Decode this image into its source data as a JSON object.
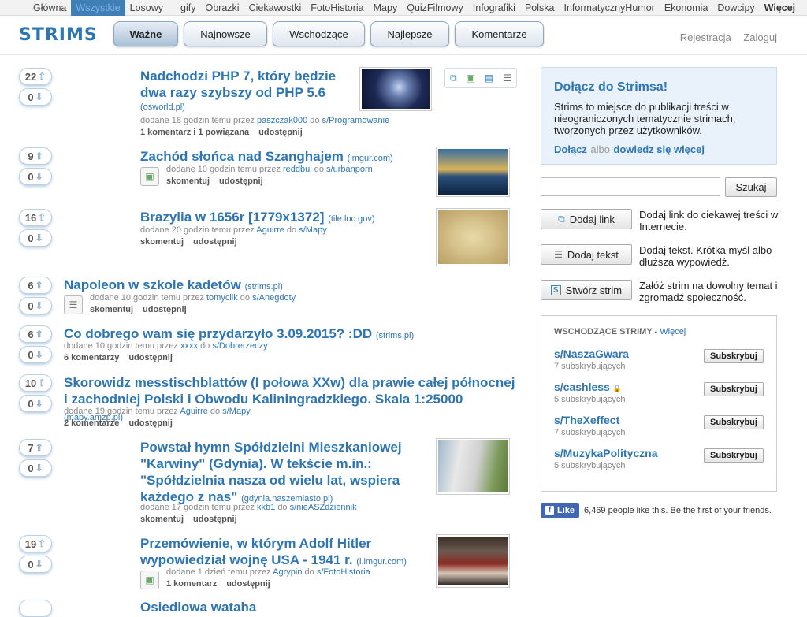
{
  "topnav": [
    {
      "label": "Główna"
    },
    {
      "label": "Wszystkie",
      "active": true
    },
    {
      "label": "Losowy"
    },
    {
      "label": "gify"
    },
    {
      "label": "Obrazki"
    },
    {
      "label": "Ciekawostki"
    },
    {
      "label": "FotoHistoria"
    },
    {
      "label": "Mapy"
    },
    {
      "label": "QuizFilmowy"
    },
    {
      "label": "Infografiki"
    },
    {
      "label": "Polska"
    },
    {
      "label": "InformatycznyHumor"
    },
    {
      "label": "Ekonomia"
    },
    {
      "label": "Dowcipy"
    },
    {
      "label": "Więcej",
      "bold": true
    }
  ],
  "logo": "STRIMS",
  "tabs": [
    "Ważne",
    "Najnowsze",
    "Wschodzące",
    "Najlepsze",
    "Komentarze"
  ],
  "auth": {
    "register": "Rejestracja",
    "login": "Zaloguj"
  },
  "posts": [
    {
      "up": "22",
      "down": "0",
      "title": "Nadchodzi PHP 7, który będzie dwa razy szybszy od PHP 5.6",
      "domain": "(osworld.pl)",
      "meta_pre": "dodane 18 godzin temu przez",
      "user": "paszczak000",
      "mid": "do",
      "strim": "s/Programowanie",
      "actions": [
        "1 komentarz i 1 powiązana",
        "udostępnij"
      ]
    },
    {
      "up": "9",
      "down": "0",
      "title": "Zachód słońca nad Szanghajem",
      "domain": "(imgur.com)",
      "meta_pre": "dodane 10 godzin temu przez",
      "user": "reddbul",
      "mid": "do",
      "strim": "s/urbanporn",
      "actions": [
        "skomentuj",
        "udostępnij"
      ]
    },
    {
      "up": "16",
      "down": "0",
      "title": "Brazylia w 1656r [1779x1372]",
      "domain": "(tile.loc.gov)",
      "meta_pre": "dodane 20 godzin temu przez",
      "user": "Aguirre",
      "mid": "do",
      "strim": "s/Mapy",
      "actions": [
        "skomentuj",
        "udostępnij"
      ]
    },
    {
      "up": "6",
      "down": "0",
      "title": "Napoleon w szkole kadetów",
      "domain": "(strims.pl)",
      "meta_pre": "dodane 10 godzin temu przez",
      "user": "tomyclik",
      "mid": "do",
      "strim": "s/Anegdoty",
      "actions": [
        "skomentuj",
        "udostępnij"
      ]
    },
    {
      "up": "6",
      "down": "0",
      "title": "Co dobrego wam się przydarzyło 3.09.2015? :DD",
      "domain": "(strims.pl)",
      "meta_pre": "dodane 10 godzin temu przez",
      "user": "xxxx",
      "mid": "do",
      "strim": "s/Dobrerzeczy",
      "actions": [
        "6 komentarzy",
        "udostępnij"
      ]
    },
    {
      "up": "10",
      "down": "0",
      "title": "Skorowidz messtischblattów (I połowa XXw) dla prawie całej północnej i zachodniej Polski i Obwodu Kaliningradzkiego. Skala 1:25000",
      "domain": "(mapy.amzp.pl)",
      "meta_pre": "dodane 19 godzin temu przez",
      "user": "Aguirre",
      "mid": "do",
      "strim": "s/Mapy",
      "actions": [
        "2 komentarze",
        "udostępnij"
      ]
    },
    {
      "up": "7",
      "down": "0",
      "title": "Powstał hymn Spółdzielni Mieszkaniowej \"Karwiny\" (Gdynia). W tekście m.in.: \"Spółdzielnia nasza od wielu lat, wspiera każdego z nas\"",
      "domain": "(gdynia.naszemiasto.pl)",
      "meta_pre": "dodane 17 godzin temu przez",
      "user": "kkb1",
      "mid": "do",
      "strim": "s/nieASZdziennik",
      "actions": [
        "skomentuj",
        "udostępnij"
      ]
    },
    {
      "up": "19",
      "down": "0",
      "title": "Przemówienie, w którym Adolf Hitler wypowiedział wojnę USA - 1941 r.",
      "domain": "(i.imgur.com)",
      "meta_pre": "dodane 1 dzień temu przez",
      "user": "Agrypin",
      "mid": "do",
      "strim": "s/FotoHistoria",
      "actions": [
        "1 komentarz",
        "udostępnij"
      ]
    },
    {
      "up": "",
      "down": "",
      "title": "Osiedlowa wataha",
      "domain": "",
      "meta_pre": "",
      "user": "",
      "mid": "",
      "strim": "",
      "actions": []
    }
  ],
  "join": {
    "title": "Dołącz do Strimsa!",
    "text": "Strims to miejsce do publikacji treści w nieograniczonych tematycznie strimach, tworzonych przez użytkowników.",
    "join": "Dołącz",
    "or": "albo",
    "learn": "dowiedz się więcej"
  },
  "search": {
    "button": "Szukaj",
    "placeholder": ""
  },
  "add": [
    {
      "label": "Dodaj link",
      "desc": "Dodaj link do ciekawej treści w Internecie."
    },
    {
      "label": "Dodaj tekst",
      "desc": "Dodaj tekst. Krótka myśl albo dłuższa wypowiedź."
    },
    {
      "label": "Stwórz strim",
      "desc": "Załóż strim na dowolny temat i zgromadź społeczność."
    }
  ],
  "rising": {
    "title": "WSCHODZĄCE STRIMY",
    "sep": " - ",
    "more": "Więcej",
    "subscribe": "Subskrybuj",
    "items": [
      {
        "name": "s/NaszaGwara",
        "subs": "7 subskrybujących"
      },
      {
        "name": "s/cashless",
        "subs": "5 subskrybujących",
        "locked": true
      },
      {
        "name": "s/TheXeffect",
        "subs": "7 subskrybujących"
      },
      {
        "name": "s/MuzykaPolityczna",
        "subs": "5 subskrybujących"
      }
    ]
  },
  "fb": {
    "like": "Like",
    "text": "6,469 people like this. Be the first of your friends."
  }
}
